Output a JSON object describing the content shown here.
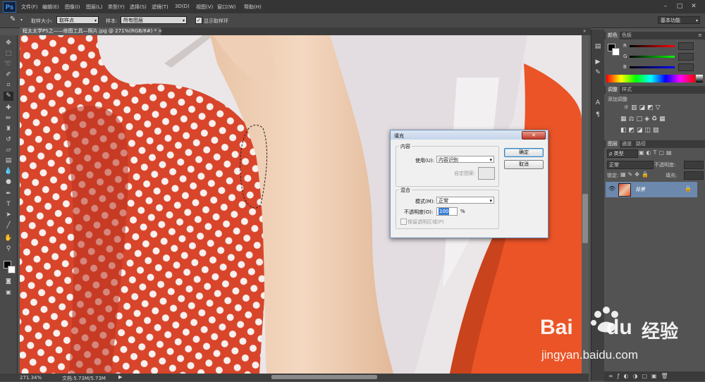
{
  "app": {
    "logo": "Ps"
  },
  "menu": [
    "文件(F)",
    "编辑(E)",
    "图像(I)",
    "图层(L)",
    "类型(Y)",
    "选择(S)",
    "滤镜(T)",
    "3D(D)",
    "视图(V)",
    "窗口(W)",
    "帮助(H)"
  ],
  "options": {
    "sample_size_label": "取样大小:",
    "sample_size_value": "取样点",
    "sample_label": "样本:",
    "sample_value": "所有图层",
    "show_ring_label": "显示取样环",
    "workspace": "基本功能"
  },
  "document": {
    "tab_title": "程太太学PS之——修图工具—照片.jpg @ 271%(RGB/8#) *",
    "close": "×"
  },
  "status": {
    "zoom": "271.34%",
    "doc_size": "文档:5.73M/5.73M"
  },
  "panels": {
    "color_tabs": [
      "颜色",
      "色板"
    ],
    "channels": [
      "R",
      "G",
      "B"
    ],
    "adjust_tabs": [
      "调整",
      "样式"
    ],
    "adjust_title": "添加调整",
    "layers_tabs": [
      "图层",
      "通道",
      "路径"
    ],
    "kind_label": "ρ 类型",
    "blend_mode": "正常",
    "opacity_label": "不透明度:",
    "lock_label": "锁定:",
    "fill_label": "填充:",
    "layer_name": "背景"
  },
  "dialog": {
    "title": "填充",
    "content_group": "内容",
    "use_label": "使用(U):",
    "use_value": "内容识别",
    "custom_pattern": "自定图案:",
    "blend_group": "混合",
    "mode_label": "模式(M):",
    "mode_value": "正常",
    "opacity_label": "不透明度(O):",
    "opacity_value": "100",
    "percent": "%",
    "preserve_label": "保留透明区域(P)",
    "ok": "确定",
    "cancel": "取消",
    "close": "✕"
  },
  "watermark": {
    "brand": "Bai",
    "brand2": "du",
    "cn": "经验",
    "url": "jingyan.baidu.com"
  },
  "colors": {
    "accent": "#3a7fd5",
    "dress": "#ea5426",
    "bow": "#d8452b"
  }
}
